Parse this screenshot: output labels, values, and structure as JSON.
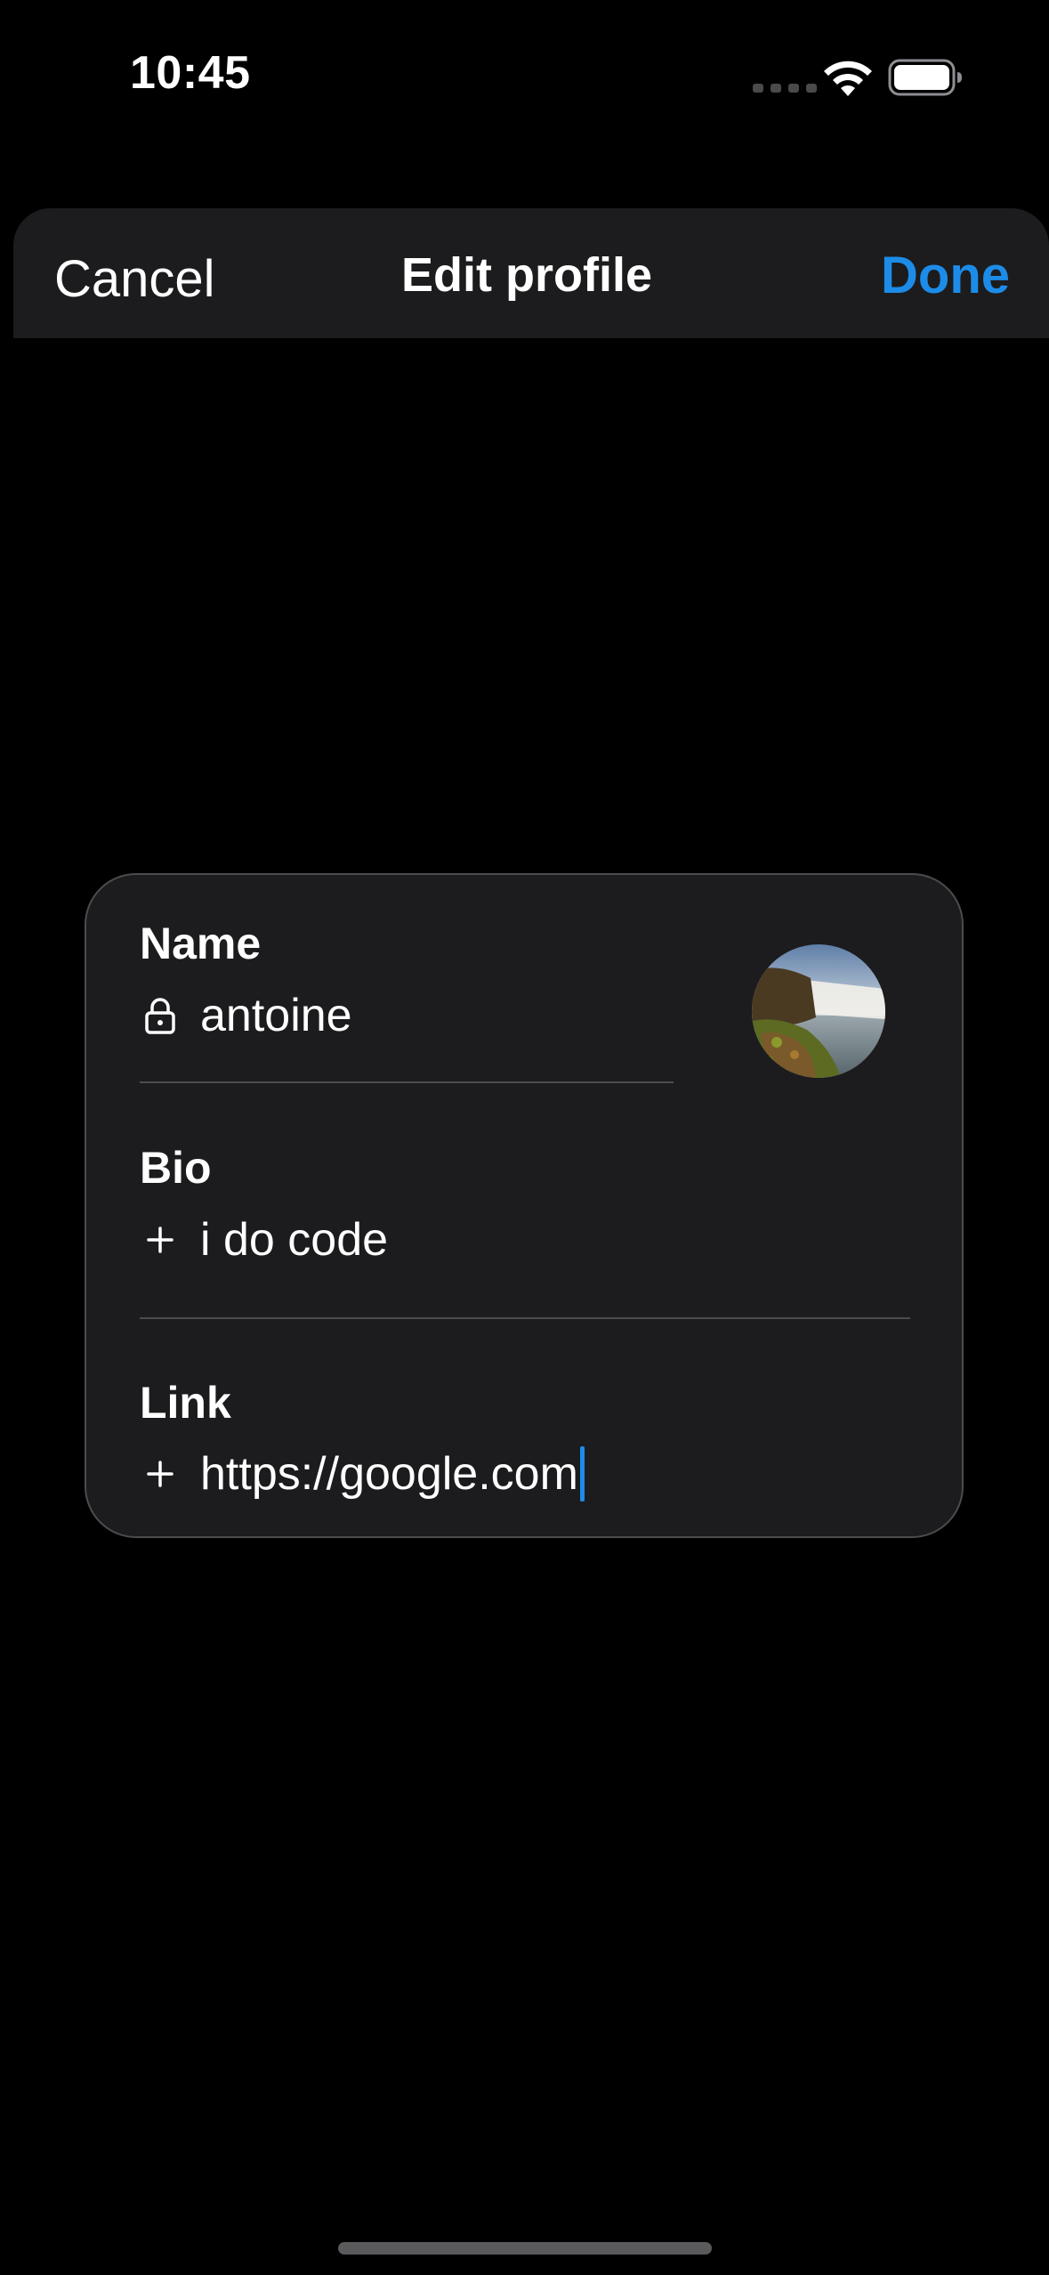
{
  "status_bar": {
    "time": "10:45"
  },
  "header": {
    "cancel_label": "Cancel",
    "title": "Edit profile",
    "done_label": "Done"
  },
  "profile": {
    "name": {
      "label": "Name",
      "value": "antoine",
      "icon": "lock-icon"
    },
    "bio": {
      "label": "Bio",
      "value": "i do code",
      "icon": "plus-icon"
    },
    "link": {
      "label": "Link",
      "value": "https://google.com",
      "icon": "plus-icon"
    },
    "avatar_icon": "avatar-image"
  },
  "colors": {
    "accent": "#1d8ce8",
    "background": "#000000",
    "surface": "#1c1c1e",
    "divider": "#4c4c4e"
  }
}
